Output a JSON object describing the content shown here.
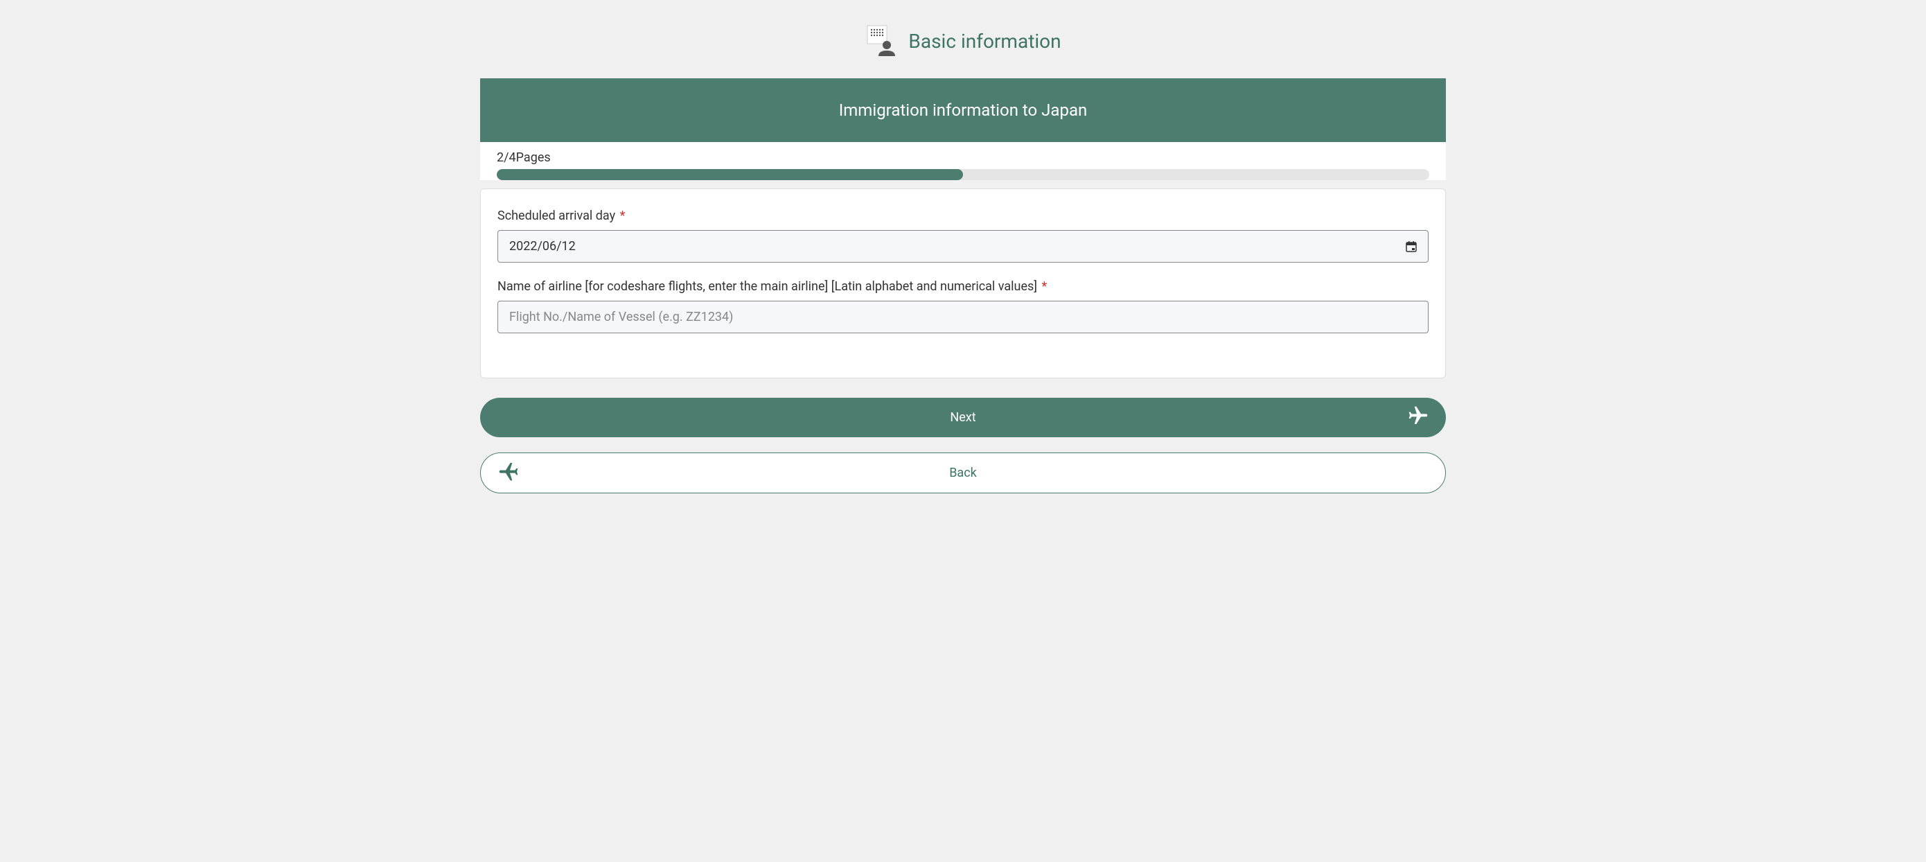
{
  "header": {
    "title": "Basic information"
  },
  "banner": {
    "title": "Immigration information to Japan"
  },
  "progress": {
    "label": "2/4Pages",
    "current": 2,
    "total": 4,
    "percent": 50
  },
  "form": {
    "arrival_day": {
      "label": "Scheduled arrival day",
      "required": true,
      "value": "2022/06/12"
    },
    "airline": {
      "label": "Name of airline [for codeshare flights, enter the main airline] [Latin alphabet and numerical values]",
      "required": true,
      "placeholder": "Flight No./Name of Vessel (e.g. ZZ1234)",
      "value": ""
    }
  },
  "buttons": {
    "next": "Next",
    "back": "Back"
  },
  "colors": {
    "primary": "#4d7d6e",
    "primary_dark": "#3d7463",
    "required": "#d03030"
  }
}
